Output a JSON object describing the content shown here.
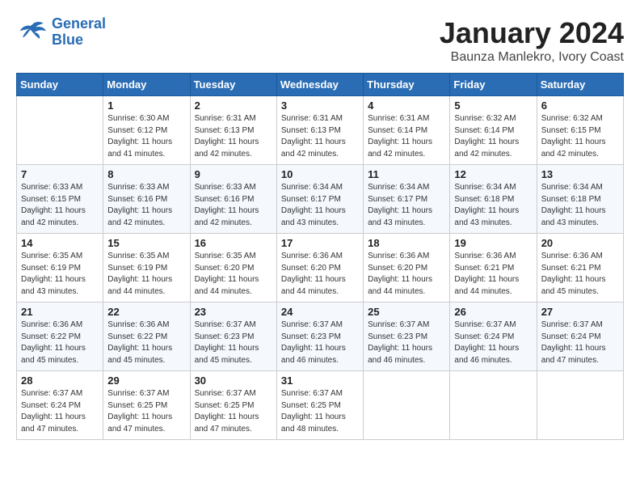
{
  "logo": {
    "line1": "General",
    "line2": "Blue"
  },
  "title": "January 2024",
  "location": "Baunza Manlekro, Ivory Coast",
  "days_of_week": [
    "Sunday",
    "Monday",
    "Tuesday",
    "Wednesday",
    "Thursday",
    "Friday",
    "Saturday"
  ],
  "weeks": [
    [
      {
        "day": "",
        "sunrise": "",
        "sunset": "",
        "daylight": ""
      },
      {
        "day": "1",
        "sunrise": "Sunrise: 6:30 AM",
        "sunset": "Sunset: 6:12 PM",
        "daylight": "Daylight: 11 hours and 41 minutes."
      },
      {
        "day": "2",
        "sunrise": "Sunrise: 6:31 AM",
        "sunset": "Sunset: 6:13 PM",
        "daylight": "Daylight: 11 hours and 42 minutes."
      },
      {
        "day": "3",
        "sunrise": "Sunrise: 6:31 AM",
        "sunset": "Sunset: 6:13 PM",
        "daylight": "Daylight: 11 hours and 42 minutes."
      },
      {
        "day": "4",
        "sunrise": "Sunrise: 6:31 AM",
        "sunset": "Sunset: 6:14 PM",
        "daylight": "Daylight: 11 hours and 42 minutes."
      },
      {
        "day": "5",
        "sunrise": "Sunrise: 6:32 AM",
        "sunset": "Sunset: 6:14 PM",
        "daylight": "Daylight: 11 hours and 42 minutes."
      },
      {
        "day": "6",
        "sunrise": "Sunrise: 6:32 AM",
        "sunset": "Sunset: 6:15 PM",
        "daylight": "Daylight: 11 hours and 42 minutes."
      }
    ],
    [
      {
        "day": "7",
        "sunrise": "Sunrise: 6:33 AM",
        "sunset": "Sunset: 6:15 PM",
        "daylight": "Daylight: 11 hours and 42 minutes."
      },
      {
        "day": "8",
        "sunrise": "Sunrise: 6:33 AM",
        "sunset": "Sunset: 6:16 PM",
        "daylight": "Daylight: 11 hours and 42 minutes."
      },
      {
        "day": "9",
        "sunrise": "Sunrise: 6:33 AM",
        "sunset": "Sunset: 6:16 PM",
        "daylight": "Daylight: 11 hours and 42 minutes."
      },
      {
        "day": "10",
        "sunrise": "Sunrise: 6:34 AM",
        "sunset": "Sunset: 6:17 PM",
        "daylight": "Daylight: 11 hours and 43 minutes."
      },
      {
        "day": "11",
        "sunrise": "Sunrise: 6:34 AM",
        "sunset": "Sunset: 6:17 PM",
        "daylight": "Daylight: 11 hours and 43 minutes."
      },
      {
        "day": "12",
        "sunrise": "Sunrise: 6:34 AM",
        "sunset": "Sunset: 6:18 PM",
        "daylight": "Daylight: 11 hours and 43 minutes."
      },
      {
        "day": "13",
        "sunrise": "Sunrise: 6:34 AM",
        "sunset": "Sunset: 6:18 PM",
        "daylight": "Daylight: 11 hours and 43 minutes."
      }
    ],
    [
      {
        "day": "14",
        "sunrise": "Sunrise: 6:35 AM",
        "sunset": "Sunset: 6:19 PM",
        "daylight": "Daylight: 11 hours and 43 minutes."
      },
      {
        "day": "15",
        "sunrise": "Sunrise: 6:35 AM",
        "sunset": "Sunset: 6:19 PM",
        "daylight": "Daylight: 11 hours and 44 minutes."
      },
      {
        "day": "16",
        "sunrise": "Sunrise: 6:35 AM",
        "sunset": "Sunset: 6:20 PM",
        "daylight": "Daylight: 11 hours and 44 minutes."
      },
      {
        "day": "17",
        "sunrise": "Sunrise: 6:36 AM",
        "sunset": "Sunset: 6:20 PM",
        "daylight": "Daylight: 11 hours and 44 minutes."
      },
      {
        "day": "18",
        "sunrise": "Sunrise: 6:36 AM",
        "sunset": "Sunset: 6:20 PM",
        "daylight": "Daylight: 11 hours and 44 minutes."
      },
      {
        "day": "19",
        "sunrise": "Sunrise: 6:36 AM",
        "sunset": "Sunset: 6:21 PM",
        "daylight": "Daylight: 11 hours and 44 minutes."
      },
      {
        "day": "20",
        "sunrise": "Sunrise: 6:36 AM",
        "sunset": "Sunset: 6:21 PM",
        "daylight": "Daylight: 11 hours and 45 minutes."
      }
    ],
    [
      {
        "day": "21",
        "sunrise": "Sunrise: 6:36 AM",
        "sunset": "Sunset: 6:22 PM",
        "daylight": "Daylight: 11 hours and 45 minutes."
      },
      {
        "day": "22",
        "sunrise": "Sunrise: 6:36 AM",
        "sunset": "Sunset: 6:22 PM",
        "daylight": "Daylight: 11 hours and 45 minutes."
      },
      {
        "day": "23",
        "sunrise": "Sunrise: 6:37 AM",
        "sunset": "Sunset: 6:23 PM",
        "daylight": "Daylight: 11 hours and 45 minutes."
      },
      {
        "day": "24",
        "sunrise": "Sunrise: 6:37 AM",
        "sunset": "Sunset: 6:23 PM",
        "daylight": "Daylight: 11 hours and 46 minutes."
      },
      {
        "day": "25",
        "sunrise": "Sunrise: 6:37 AM",
        "sunset": "Sunset: 6:23 PM",
        "daylight": "Daylight: 11 hours and 46 minutes."
      },
      {
        "day": "26",
        "sunrise": "Sunrise: 6:37 AM",
        "sunset": "Sunset: 6:24 PM",
        "daylight": "Daylight: 11 hours and 46 minutes."
      },
      {
        "day": "27",
        "sunrise": "Sunrise: 6:37 AM",
        "sunset": "Sunset: 6:24 PM",
        "daylight": "Daylight: 11 hours and 47 minutes."
      }
    ],
    [
      {
        "day": "28",
        "sunrise": "Sunrise: 6:37 AM",
        "sunset": "Sunset: 6:24 PM",
        "daylight": "Daylight: 11 hours and 47 minutes."
      },
      {
        "day": "29",
        "sunrise": "Sunrise: 6:37 AM",
        "sunset": "Sunset: 6:25 PM",
        "daylight": "Daylight: 11 hours and 47 minutes."
      },
      {
        "day": "30",
        "sunrise": "Sunrise: 6:37 AM",
        "sunset": "Sunset: 6:25 PM",
        "daylight": "Daylight: 11 hours and 47 minutes."
      },
      {
        "day": "31",
        "sunrise": "Sunrise: 6:37 AM",
        "sunset": "Sunset: 6:25 PM",
        "daylight": "Daylight: 11 hours and 48 minutes."
      },
      {
        "day": "",
        "sunrise": "",
        "sunset": "",
        "daylight": ""
      },
      {
        "day": "",
        "sunrise": "",
        "sunset": "",
        "daylight": ""
      },
      {
        "day": "",
        "sunrise": "",
        "sunset": "",
        "daylight": ""
      }
    ]
  ]
}
